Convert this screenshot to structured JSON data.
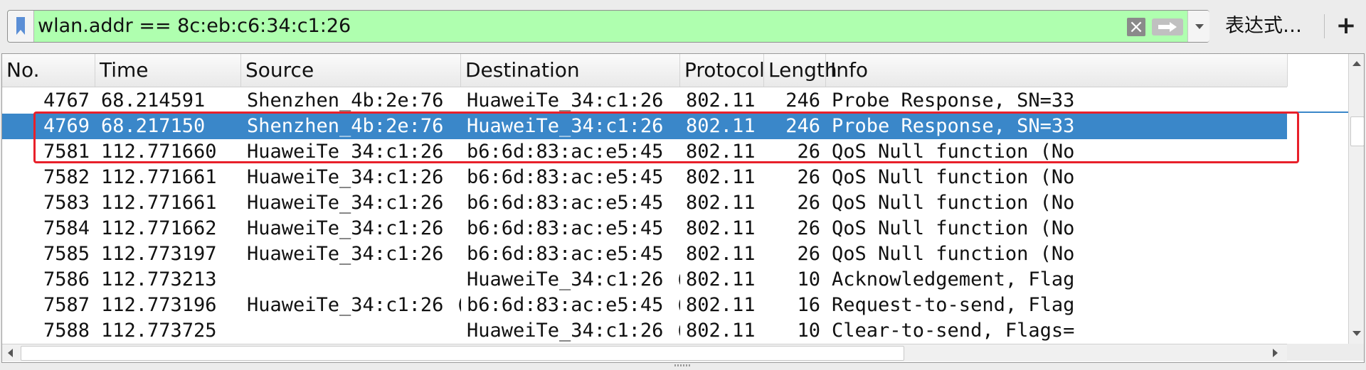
{
  "filter": {
    "value": "wlan.addr == 8c:eb:c6:34:c1:26",
    "expression_label": "表达式…",
    "add_label": "+",
    "clear_glyph": "×",
    "bg_color": "#afffaf"
  },
  "columns": [
    {
      "key": "no",
      "label": "No."
    },
    {
      "key": "time",
      "label": "Time"
    },
    {
      "key": "source",
      "label": "Source"
    },
    {
      "key": "destination",
      "label": "Destination"
    },
    {
      "key": "protocol",
      "label": "Protocol"
    },
    {
      "key": "length",
      "label": "Length"
    },
    {
      "key": "info",
      "label": "Info"
    }
  ],
  "rows": [
    {
      "no": "4767",
      "time": "68.214591",
      "source": "Shenzhen_4b:2e:76",
      "destination": "HuaweiTe_34:c1:26",
      "protocol": "802.11",
      "length": "246",
      "info": "Probe Response, SN=33",
      "selected": false
    },
    {
      "no": "4769",
      "time": "68.217150",
      "source": "Shenzhen_4b:2e:76",
      "destination": "HuaweiTe_34:c1:26",
      "protocol": "802.11",
      "length": "246",
      "info": "Probe Response, SN=33",
      "selected": true
    },
    {
      "no": "7581",
      "time": "112.771660",
      "source": "HuaweiTe_34:c1:26",
      "destination": "b6:6d:83:ac:e5:45",
      "protocol": "802.11",
      "length": "26",
      "info": "QoS Null function (No",
      "selected": false
    },
    {
      "no": "7582",
      "time": "112.771661",
      "source": "HuaweiTe_34:c1:26",
      "destination": "b6:6d:83:ac:e5:45",
      "protocol": "802.11",
      "length": "26",
      "info": "QoS Null function (No",
      "selected": false
    },
    {
      "no": "7583",
      "time": "112.771661",
      "source": "HuaweiTe_34:c1:26",
      "destination": "b6:6d:83:ac:e5:45",
      "protocol": "802.11",
      "length": "26",
      "info": "QoS Null function (No",
      "selected": false
    },
    {
      "no": "7584",
      "time": "112.771662",
      "source": "HuaweiTe_34:c1:26",
      "destination": "b6:6d:83:ac:e5:45",
      "protocol": "802.11",
      "length": "26",
      "info": "QoS Null function (No",
      "selected": false
    },
    {
      "no": "7585",
      "time": "112.773197",
      "source": "HuaweiTe_34:c1:26",
      "destination": "b6:6d:83:ac:e5:45",
      "protocol": "802.11",
      "length": "26",
      "info": "QoS Null function (No",
      "selected": false
    },
    {
      "no": "7586",
      "time": "112.773213",
      "source": "",
      "destination": "HuaweiTe_34:c1:26 (…",
      "protocol": "802.11",
      "length": "10",
      "info": "Acknowledgement, Flag",
      "selected": false
    },
    {
      "no": "7587",
      "time": "112.773196",
      "source": "HuaweiTe_34:c1:26 (…",
      "destination": "b6:6d:83:ac:e5:45 (…",
      "protocol": "802.11",
      "length": "16",
      "info": "Request-to-send, Flag",
      "selected": false
    },
    {
      "no": "7588",
      "time": "112.773725",
      "source": "",
      "destination": "HuaweiTe_34:c1:26 (…",
      "protocol": "802.11",
      "length": "10",
      "info": "Clear-to-send, Flags=",
      "selected": false
    }
  ],
  "colors": {
    "selected_row": "#3a87c9",
    "annotation": "#e8202a"
  },
  "icons": {
    "bookmark": "bookmark-icon",
    "clear": "clear-icon",
    "apply": "arrow-right-icon",
    "dropdown": "chevron-down-icon"
  }
}
